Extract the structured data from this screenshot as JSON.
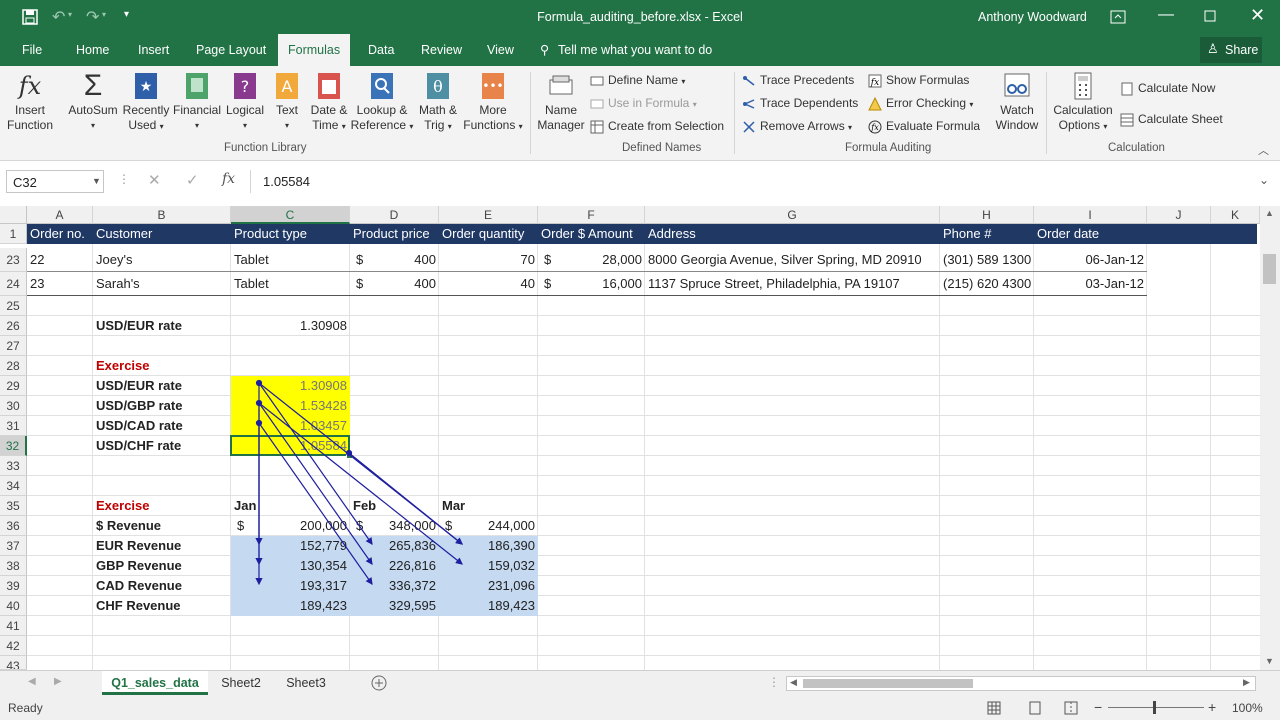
{
  "window": {
    "title": "Formula_auditing_before.xlsx - Excel",
    "user": "Anthony Woodward"
  },
  "tabs": {
    "file": "File",
    "home": "Home",
    "insert": "Insert",
    "page_layout": "Page Layout",
    "formulas": "Formulas",
    "data": "Data",
    "review": "Review",
    "view": "View",
    "tell_me": "Tell me what you want to do",
    "share": "Share"
  },
  "ribbon": {
    "insert_function": [
      "Insert",
      "Function"
    ],
    "autosum": "AutoSum",
    "recently_used": [
      "Recently",
      "Used"
    ],
    "financial": "Financial",
    "logical": "Logical",
    "text": "Text",
    "date_time": [
      "Date &",
      "Time"
    ],
    "lookup_reference": [
      "Lookup &",
      "Reference"
    ],
    "math_trig": [
      "Math &",
      "Trig"
    ],
    "more_functions": [
      "More",
      "Functions"
    ],
    "function_library": "Function Library",
    "name_manager": [
      "Name",
      "Manager"
    ],
    "define_name": "Define Name",
    "use_in_formula": "Use in Formula",
    "create_from_selection": "Create from Selection",
    "defined_names": "Defined Names",
    "trace_precedents": "Trace Precedents",
    "trace_dependents": "Trace Dependents",
    "remove_arrows": "Remove Arrows",
    "show_formulas": "Show Formulas",
    "error_checking": "Error Checking",
    "evaluate_formula": "Evaluate Formula",
    "watch_window": [
      "Watch",
      "Window"
    ],
    "formula_auditing": "Formula Auditing",
    "calculation_options": [
      "Calculation",
      "Options"
    ],
    "calculate_now": "Calculate Now",
    "calculate_sheet": "Calculate Sheet",
    "calculation": "Calculation"
  },
  "formula_bar": {
    "name_box": "C32",
    "fx": "fx",
    "value": "1.05584"
  },
  "columns": [
    "A",
    "B",
    "C",
    "D",
    "E",
    "F",
    "G",
    "H",
    "I",
    "J",
    "K"
  ],
  "rows": [
    "1",
    "23",
    "24",
    "25",
    "26",
    "27",
    "28",
    "29",
    "30",
    "31",
    "32",
    "33",
    "34",
    "35",
    "36",
    "37",
    "38",
    "39",
    "40",
    "41",
    "42",
    "43"
  ],
  "header_row": {
    "a": "Order no.",
    "b": "Customer",
    "c": "Product type",
    "d": "Product price",
    "e": "Order quantity",
    "f": "Order $ Amount",
    "g": "Address",
    "h": "Phone #",
    "i": "Order date"
  },
  "orders": [
    {
      "no": "22",
      "customer": "Joey's",
      "type": "Tablet",
      "cur": "$",
      "price": "400",
      "qty": "70",
      "cur2": "$",
      "amount": "28,000",
      "address": "8000 Georgia Avenue, Silver Spring, MD 20910",
      "phone": "(301) 589 1300",
      "date": "06-Jan-12"
    },
    {
      "no": "23",
      "customer": "Sarah's",
      "type": "Tablet",
      "cur": "$",
      "price": "400",
      "qty": "40",
      "cur2": "$",
      "amount": "16,000",
      "address": "1137 Spruce Street, Philadelphia, PA 19107",
      "phone": "(215) 620 4300",
      "date": "03-Jan-12"
    }
  ],
  "rate": {
    "label": "USD/EUR rate",
    "value": "1.30908"
  },
  "exercise1": {
    "title": "Exercise",
    "rates": [
      {
        "label": "USD/EUR rate",
        "value": "1.30908"
      },
      {
        "label": "USD/GBP rate",
        "value": "1.53428"
      },
      {
        "label": "USD/CAD rate",
        "value": "1.03457"
      },
      {
        "label": "USD/CHF rate",
        "value": "1.05584"
      }
    ]
  },
  "exercise2": {
    "title": "Exercise",
    "months": [
      "Jan",
      "Feb",
      "Mar"
    ],
    "revenue_label": "$ Revenue",
    "currency": "$",
    "revenue": [
      "200,000",
      "348,000",
      "244,000"
    ],
    "rows": [
      {
        "label": "EUR Revenue",
        "values": [
          "152,779",
          "265,836",
          "186,390"
        ]
      },
      {
        "label": "GBP Revenue",
        "values": [
          "130,354",
          "226,816",
          "159,032"
        ]
      },
      {
        "label": "CAD Revenue",
        "values": [
          "193,317",
          "336,372",
          "231,096"
        ]
      },
      {
        "label": "CHF Revenue",
        "values": [
          "189,423",
          "329,595",
          "189,423"
        ]
      }
    ]
  },
  "sheets": [
    "Q1_sales_data",
    "Sheet2",
    "Sheet3"
  ],
  "status": {
    "ready": "Ready",
    "zoom": "100%"
  },
  "colors": {
    "excel_green": "#217346",
    "header_navy": "#1f3864",
    "highlight_yellow": "#ffff00",
    "highlight_blue": "#c5d9f1",
    "exercise_red": "#c00000",
    "trace_arrow": "#1f1fa0"
  }
}
